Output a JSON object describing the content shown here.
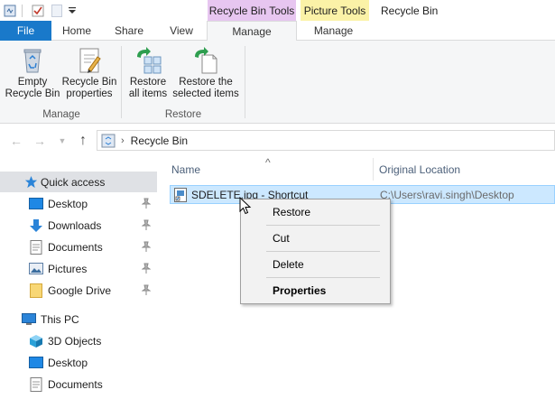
{
  "titlebar": {
    "qat_icons": [
      "properties-icon",
      "checkmark-icon",
      "new-folder-icon",
      "customize-arrow-icon"
    ],
    "context_tabs": [
      {
        "label": "Recycle Bin Tools",
        "color": "#e7c6f0"
      },
      {
        "label": "Picture Tools",
        "color": "#fbf2a7"
      }
    ],
    "window_title": "Recycle Bin"
  },
  "tabs": [
    {
      "label": "File"
    },
    {
      "label": "Home"
    },
    {
      "label": "Share"
    },
    {
      "label": "View"
    },
    {
      "label": "Manage"
    },
    {
      "label": "Manage"
    }
  ],
  "ribbon": {
    "buttons": [
      {
        "label_line1": "Empty",
        "label_line2": "Recycle Bin",
        "icon": "recycle-bin-icon"
      },
      {
        "label_line1": "Recycle Bin",
        "label_line2": "properties",
        "icon": "properties-icon"
      },
      {
        "label_line1": "Restore",
        "label_line2": "all items",
        "icon": "restore-all-icon"
      },
      {
        "label_line1": "Restore the",
        "label_line2": "selected items",
        "icon": "restore-selected-icon"
      }
    ],
    "groups": [
      {
        "label": "Manage"
      },
      {
        "label": "Restore"
      }
    ]
  },
  "address": {
    "crumb": "Recycle Bin"
  },
  "navpane": {
    "items": [
      {
        "label": "Quick access",
        "icon": "star-icon",
        "pinned": false
      },
      {
        "label": "Desktop",
        "icon": "desktop-folder-icon",
        "pinned": true
      },
      {
        "label": "Downloads",
        "icon": "download-arrow-icon",
        "pinned": true
      },
      {
        "label": "Documents",
        "icon": "documents-icon",
        "pinned": true
      },
      {
        "label": "Pictures",
        "icon": "pictures-icon",
        "pinned": true
      },
      {
        "label": "Google Drive",
        "icon": "folder-icon",
        "pinned": true
      },
      {
        "label": "This PC",
        "icon": "computer-icon",
        "pinned": false
      },
      {
        "label": "3D Objects",
        "icon": "cube-icon",
        "pinned": false
      },
      {
        "label": "Desktop",
        "icon": "desktop-folder-icon",
        "pinned": false
      },
      {
        "label": "Documents",
        "icon": "documents-icon",
        "pinned": false
      }
    ]
  },
  "filelist": {
    "columns": [
      {
        "label": "Name"
      },
      {
        "label": "Original Location"
      }
    ],
    "sort_indicator": "^",
    "rows": [
      {
        "name": "SDELETE.jpg - Shortcut",
        "location": "C:\\Users\\ravi.singh\\Desktop"
      }
    ]
  },
  "context_menu": {
    "items": [
      {
        "label": "Restore"
      },
      {
        "label": "Cut"
      },
      {
        "label": "Delete"
      },
      {
        "label": "Properties",
        "bold": true
      }
    ]
  },
  "colors": {
    "file_tab": "#1979ca",
    "selection": "#cce8ff",
    "ribbon_bg": "#f5f6f7"
  }
}
